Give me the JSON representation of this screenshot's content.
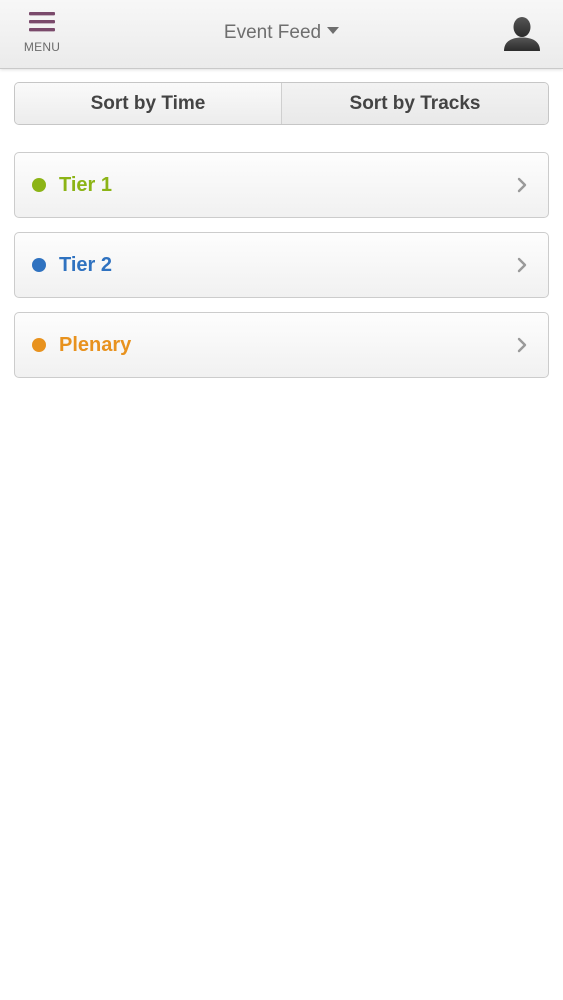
{
  "header": {
    "menu_label": "MENU",
    "menu_icon": "hamburger-icon",
    "title": "Event Feed",
    "title_icon": "caret-down-icon",
    "profile_icon": "user-silhouette-icon",
    "accent_color": "#7a4a6b"
  },
  "sort": {
    "options": [
      {
        "label": "Sort by Time"
      },
      {
        "label": "Sort by Tracks"
      }
    ]
  },
  "tracks": [
    {
      "label": "Tier 1",
      "color": "#8cb416"
    },
    {
      "label": "Tier 2",
      "color": "#2f72c0"
    },
    {
      "label": "Plenary",
      "color": "#e8921e"
    }
  ]
}
